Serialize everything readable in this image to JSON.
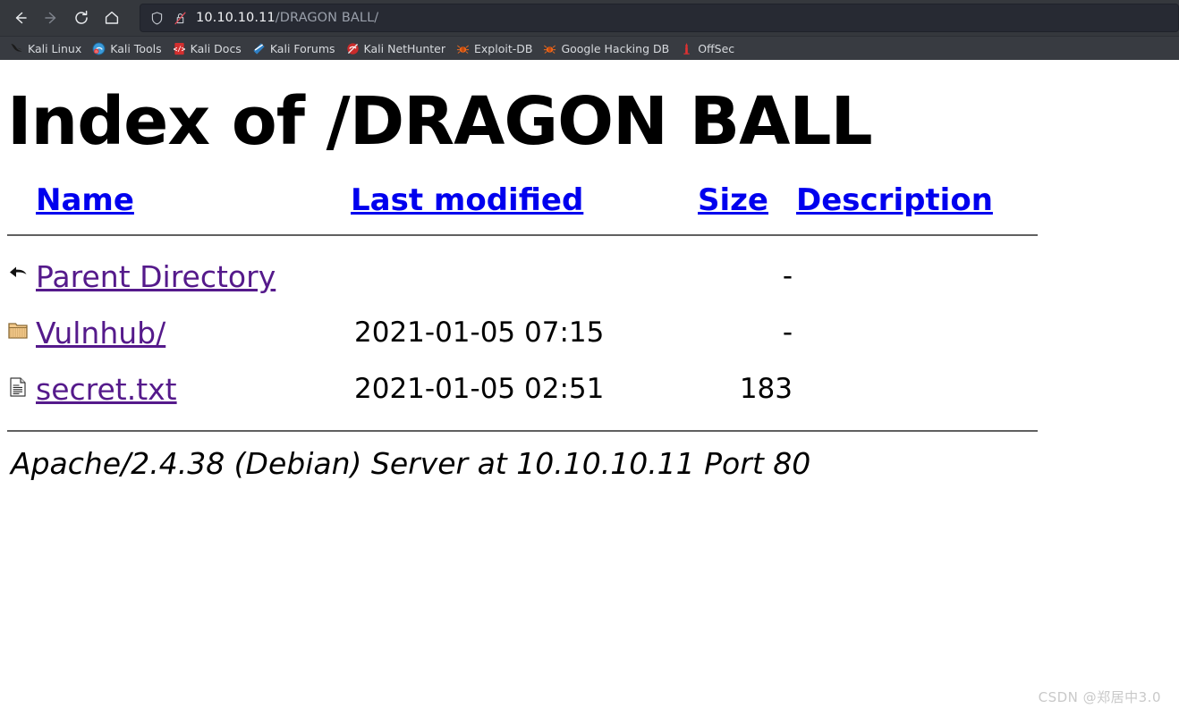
{
  "browser": {
    "nav": {
      "back": "back-arrow",
      "forward": "forward-arrow",
      "reload": "reload",
      "home": "home"
    },
    "url": {
      "host": "10.10.10.11",
      "path": "/DRAGON BALL/",
      "full": "10.10.10.11/DRAGON BALL/",
      "shield_icon": "tracking-protection-shield",
      "lock_icon": "insecure-lock-crossed"
    },
    "bookmarks": [
      {
        "label": "Kali Linux",
        "icon": "kali-dragon-icon"
      },
      {
        "label": "Kali Tools",
        "icon": "kali-tools-icon"
      },
      {
        "label": "Kali Docs",
        "icon": "kali-docs-icon"
      },
      {
        "label": "Kali Forums",
        "icon": "kali-forums-icon"
      },
      {
        "label": "Kali NetHunter",
        "icon": "kali-nethunter-icon"
      },
      {
        "label": "Exploit-DB",
        "icon": "exploit-db-icon"
      },
      {
        "label": "Google Hacking DB",
        "icon": "google-hacking-db-icon"
      },
      {
        "label": "OffSec",
        "icon": "offsec-icon"
      }
    ]
  },
  "page": {
    "title": "Index of /DRAGON BALL",
    "columns": [
      {
        "label": "Name"
      },
      {
        "label": "Last modified"
      },
      {
        "label": "Size"
      },
      {
        "label": "Description"
      }
    ],
    "rows": [
      {
        "icon": "parent-directory-icon",
        "name": "Parent Directory",
        "modified": "",
        "size": "-",
        "description": ""
      },
      {
        "icon": "folder-icon",
        "name": "Vulnhub/",
        "modified": "2021-01-05 07:15",
        "size": "-",
        "description": ""
      },
      {
        "icon": "text-file-icon",
        "name": "secret.txt",
        "modified": "2021-01-05 02:51",
        "size": "183",
        "description": ""
      }
    ],
    "server_signature": "Apache/2.4.38 (Debian) Server at 10.10.10.11 Port 80",
    "watermark": "CSDN @郑居中3.0"
  },
  "colors": {
    "link_unvisited": "#0000ee",
    "link_visited": "#551a8b",
    "chrome_bg": "#35383d",
    "bookmark_bg": "#383b41",
    "urlbar_bg": "#272a33",
    "rule": "#606060"
  }
}
